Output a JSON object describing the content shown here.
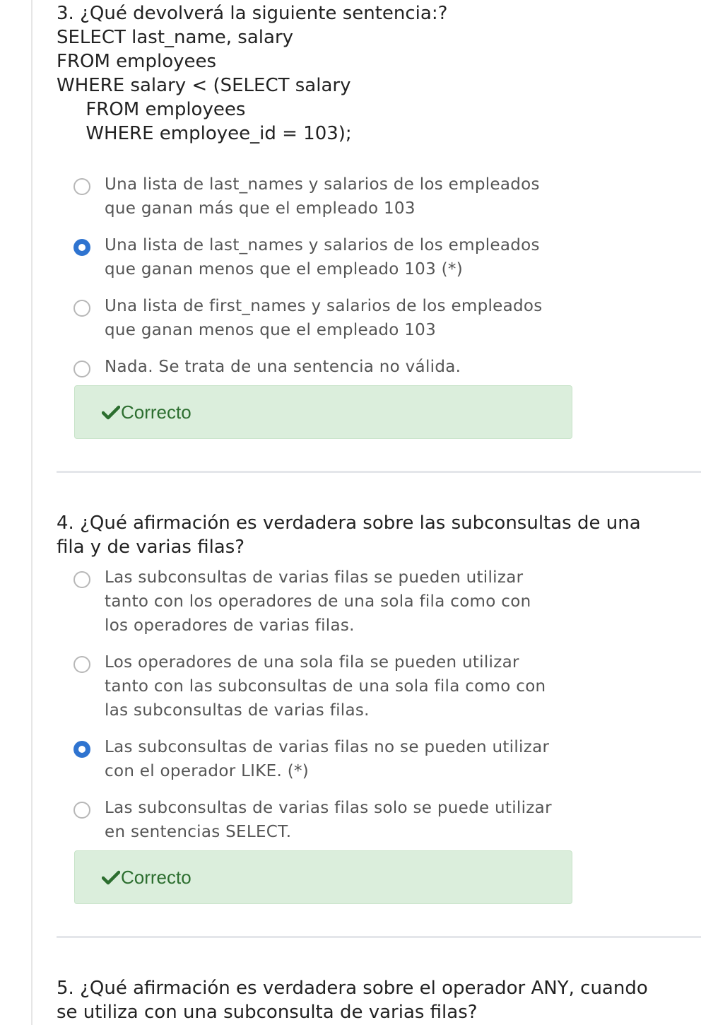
{
  "questions": [
    {
      "title_lines": [
        "3. ¿Qué devolverá la siguiente sentencia:?",
        "SELECT last_name, salary",
        "FROM employees",
        "WHERE salary < (SELECT salary",
        "     FROM employees",
        "     WHERE employee_id = 103);"
      ],
      "options": [
        {
          "lines": [
            "Una lista de last_names y salarios de los empleados",
            "que ganan más que el empleado 103"
          ],
          "selected": false
        },
        {
          "lines": [
            "Una lista de last_names y salarios de los empleados",
            "que ganan menos que el empleado 103 (*)"
          ],
          "selected": true
        },
        {
          "lines": [
            "Una lista de first_names y salarios de los empleados",
            "que ganan menos que el empleado 103"
          ],
          "selected": false
        },
        {
          "lines": [
            "Nada. Se trata de una sentencia no válida."
          ],
          "selected": false
        }
      ],
      "feedback": "Correcto"
    },
    {
      "title_lines": [
        "4. ¿Qué afirmación es verdadera sobre las subconsultas de una",
        "fila y de varias filas?"
      ],
      "options": [
        {
          "lines": [
            "Las subconsultas de varias filas se pueden utilizar",
            "tanto con los operadores de una sola fila como con",
            "los operadores de varias filas."
          ],
          "selected": false
        },
        {
          "lines": [
            "Los operadores de una sola fila se pueden utilizar",
            "tanto con las subconsultas de una sola fila como con",
            "las subconsultas de varias filas."
          ],
          "selected": false
        },
        {
          "lines": [
            "Las subconsultas de varias filas no se pueden utilizar",
            "con el operador LIKE. (*)"
          ],
          "selected": true
        },
        {
          "lines": [
            "Las subconsultas de varias filas solo se puede utilizar",
            "en sentencias SELECT."
          ],
          "selected": false
        }
      ],
      "feedback": "Correcto"
    },
    {
      "title_lines": [
        "5. ¿Qué afirmación es verdadera sobre el operador ANY, cuando",
        "se utiliza con una subconsulta de varias filas?"
      ]
    }
  ],
  "colors": {
    "radio_selected": "#2f74d0",
    "feedback_bg": "#dbeedc",
    "feedback_text": "#2c6e2f"
  },
  "icons": {
    "feedback": "check-icon"
  }
}
